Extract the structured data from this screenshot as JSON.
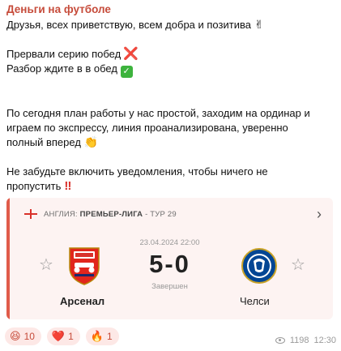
{
  "post": {
    "channel_name": "Деньги на футболе",
    "greeting": "Друзья, всех приветствую, всем добра и позитива",
    "greeting_emoji": "✌",
    "lost_streak": "Прервали серию побед",
    "lost_streak_mark": "❌",
    "analysis": "Разбор ждите в в обед",
    "analysis_mark": "✅",
    "plan_line1": "По сегодня план работы у нас простой, заходим на ординар и",
    "plan_line2": "играем по экспрессу, линия проанализирована, уверенно",
    "plan_line3": "полный вперед",
    "plan_emoji": "👏",
    "notify_line1": "Не забудьте включить уведомления, чтобы ничего не",
    "notify_line2": "пропустить",
    "notify_mark": "‼"
  },
  "match_card": {
    "country": "АНГЛИЯ:",
    "league": "ПРЕМЬЕР-ЛИГА",
    "round": "- ТУР 29",
    "date": "23.04.2024 22:00",
    "score": "5-0",
    "status": "Завершен",
    "home_team": "Арсенал",
    "away_team": "Челси",
    "accent_color": "#e05b4a"
  },
  "reactions": [
    {
      "emoji": "😆",
      "count": "10"
    },
    {
      "emoji": "❤️",
      "count": "1"
    },
    {
      "emoji": "🔥",
      "count": "1"
    }
  ],
  "meta": {
    "views": "1198",
    "time": "12:30"
  }
}
